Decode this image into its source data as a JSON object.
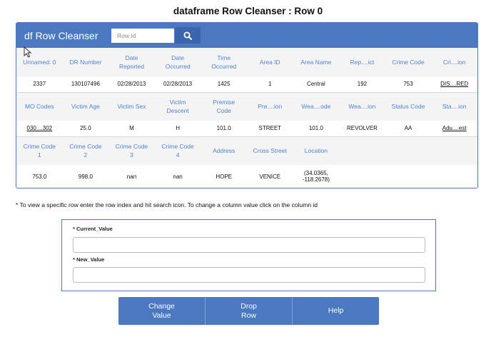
{
  "page": {
    "title": "dataframe Row Cleanser : Row 0"
  },
  "panel": {
    "title": "df Row Cleanser",
    "search_placeholder": "Row Id",
    "search_icon": "search-icon"
  },
  "table": {
    "row1": {
      "headers": [
        "Unnamed: 0",
        "DR Number",
        "Date\nReported",
        "Date\nOccurred",
        "Time\nOccurred",
        "Area ID",
        "Area Name",
        "Rep....ict",
        "Crime Code",
        "Cri....ion"
      ],
      "values": [
        "2337",
        "130107496",
        "02/28/2013",
        "02/28/2013",
        "1425",
        "1",
        "Central",
        "192",
        "753",
        "DIS....RED"
      ]
    },
    "row2": {
      "headers": [
        "MO Codes",
        "Victim Age",
        "Victim Sex",
        "Victim\nDescent",
        "Premise\nCode",
        "Pre....ion",
        "Wea....ode",
        "Wea....ion",
        "Status Code",
        "Sta....ion"
      ],
      "values": [
        "030....302",
        "25.0",
        "M",
        "H",
        "101.0",
        "STREET",
        "101.0",
        "REVOLVER",
        "AA",
        "Adu....est"
      ]
    },
    "row3": {
      "headers": [
        "Crime Code\n1",
        "Crime Code\n2",
        "Crime Code\n3",
        "Crime Code\n4",
        "Address",
        "Cross Street",
        "Location",
        "",
        "",
        ""
      ],
      "values": [
        "753.0",
        "998.0",
        "nan",
        "nan",
        "HOPE",
        "VENICE",
        "(34.0365,\n-118.2678)",
        "",
        "",
        ""
      ]
    }
  },
  "note": "* To view a specific row enter the row index and hit search icon. To change a column value click on the column id",
  "form": {
    "current_label": "* Current_Value",
    "current_value": "",
    "new_label": "* New_Value",
    "new_value": ""
  },
  "buttons": {
    "change": "Change\nValue",
    "drop": "Drop\nRow",
    "help": "Help"
  },
  "colors": {
    "accent": "#4a79bf",
    "header_text": "#4f83cf",
    "link": "#2f5bb0"
  }
}
